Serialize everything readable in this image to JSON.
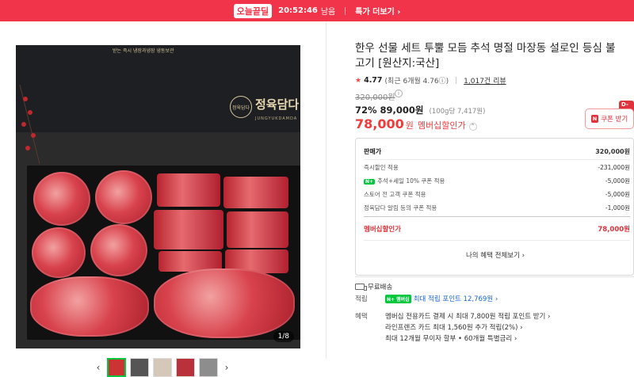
{
  "banner": {
    "logo": "오늘끝딜",
    "timer": "20:52:46",
    "timer_suffix": "남음",
    "more": "특가 더보기 ›"
  },
  "gallery": {
    "box_tag": "받는 즉시 냉장과냉장 냉동보관",
    "emblem": "정육담다",
    "brand": "정육담다",
    "brand_sub": "JUNGYUKDAMDA",
    "counter": "1/8",
    "prev": "‹",
    "next": "›"
  },
  "product": {
    "title": "한우 선물 세트 투뿔 모듬 추석 명절 마장동 설로인 등심 불고기 [원산지:국산]",
    "rating": {
      "score": "4.77",
      "recent": "(최근 6개월 4.76ⓘ)",
      "reviews": "1,017건 리뷰"
    },
    "original_price": "320,000원",
    "discount_line": "72% 89,000원",
    "unit_price": "(100g당 7,417원)",
    "member_price": "78,000",
    "member_won": "원",
    "member_label": "멤버십할인가",
    "coupon": {
      "badge": "N",
      "label": "쿠폰 받기",
      "dday": "D-7"
    }
  },
  "breakdown": {
    "rows": [
      {
        "label": "판매가",
        "amount": "320,000원"
      },
      {
        "label": "즉시할인 적용",
        "amount": "-231,000원"
      },
      {
        "label": "추석+세일 10% 쿠폰 적용",
        "amount": "-5,000원"
      },
      {
        "label": "스토어 전 고객 쿠폰 적용",
        "amount": "-5,000원"
      },
      {
        "label": "정육담다 알림 등의 쿠폰 적용",
        "amount": "-1,000원"
      }
    ],
    "total_label": "멤버십할인가",
    "total_amount": "78,000원",
    "link": "나의 혜택 전체보기 ›"
  },
  "shipping": {
    "label": "무료배송"
  },
  "points": {
    "label": "적립",
    "badge": "N+ 멤버십",
    "text": "최대 적립 포인트 12,769원 ›"
  },
  "benefits": {
    "label": "혜택",
    "items": [
      "멤버십 전용카드 결제 시 최대 7,800원 적립 포인트 받기 ›",
      "라인프렌즈 카드 최대 1,560원 추가 적립(2%) ›",
      "최대 12개월 무이자 할부 • 60개월 특별금리 ›"
    ]
  },
  "colors": {
    "accent": "#f2344a",
    "naver_green": "#00c73c",
    "price_red": "#f03b3b",
    "link_blue": "#1a66d6"
  }
}
